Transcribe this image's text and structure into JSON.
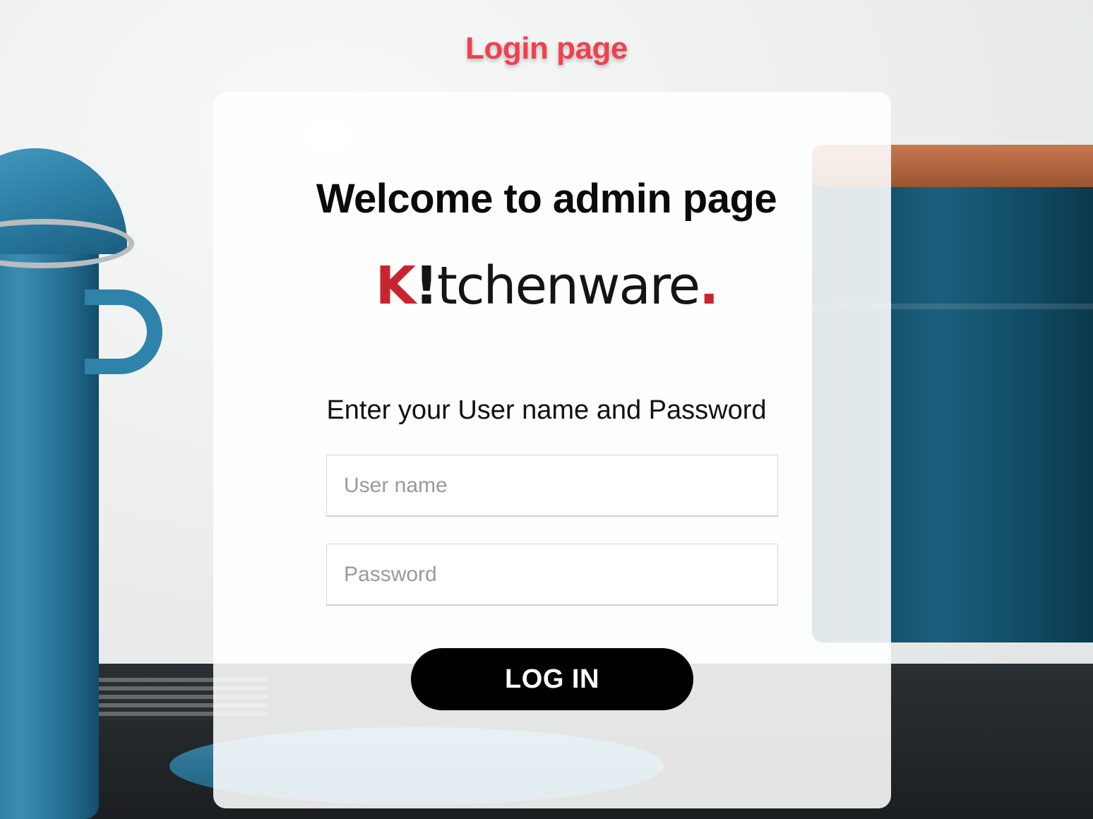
{
  "header": {
    "title": "Login page"
  },
  "card": {
    "welcome": "Welcome to admin page",
    "logo": {
      "k": "K",
      "bang": "!",
      "rest": "tchenware",
      "dot": "."
    },
    "instructions": "Enter your User name and Password",
    "username": {
      "placeholder": "User name",
      "value": ""
    },
    "password": {
      "placeholder": "Password",
      "value": ""
    },
    "login_label": "LOG IN"
  },
  "colors": {
    "title": "#f0404f",
    "logo_accent": "#c8242f",
    "button_bg": "#000000",
    "button_text": "#ffffff"
  },
  "icons": [
    "background-kitchenware-photo"
  ]
}
